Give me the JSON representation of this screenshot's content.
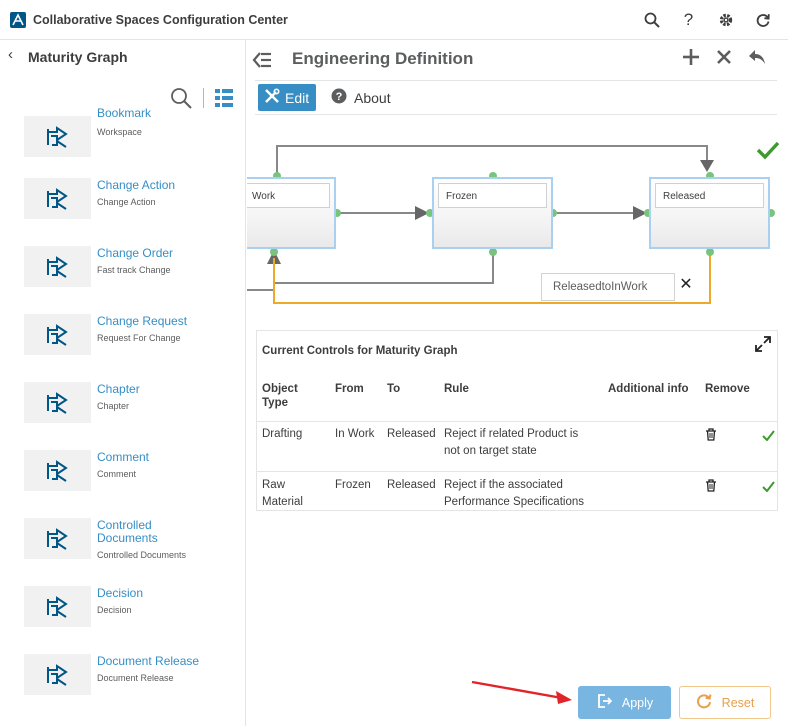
{
  "app": {
    "title": "Collaborative Spaces Configuration Center"
  },
  "left_panel": {
    "title": "Maturity Graph",
    "items": [
      {
        "title": "Bookmark",
        "sub": "Workspace"
      },
      {
        "title": "Change Action",
        "sub": "Change Action"
      },
      {
        "title": "Change Order",
        "sub": "Fast track Change"
      },
      {
        "title": "Change Request",
        "sub": "Request For Change"
      },
      {
        "title": "Chapter",
        "sub": "Chapter"
      },
      {
        "title": "Comment",
        "sub": "Comment"
      },
      {
        "title": "Controlled Documents",
        "sub": "Controlled Documents"
      },
      {
        "title": "Decision",
        "sub": "Decision"
      },
      {
        "title": "Document Release",
        "sub": "Document Release"
      }
    ]
  },
  "main": {
    "title": "Engineering Definition",
    "tabs": {
      "edit": "Edit",
      "about": "About"
    },
    "graph": {
      "states": [
        "Work",
        "Frozen",
        "Released"
      ],
      "tooltip": "ReleasedtoInWork"
    },
    "controls": {
      "title": "Current Controls for Maturity Graph",
      "columns": [
        "Object Type",
        "From",
        "To",
        "Rule",
        "Additional info",
        "Remove"
      ],
      "rows": [
        {
          "object_type": "Drafting",
          "from": "In Work",
          "to": "Released",
          "rule": "Reject if related Product is not on target state"
        },
        {
          "object_type": "Raw Material",
          "from": "Frozen",
          "to": "Released",
          "rule": "Reject if the associated Performance Specifications"
        }
      ]
    }
  },
  "footer": {
    "apply": "Apply",
    "reset": "Reset"
  },
  "colors": {
    "accent": "#368ec4",
    "success": "#3e9a2e",
    "reset": "#e8a04a"
  }
}
